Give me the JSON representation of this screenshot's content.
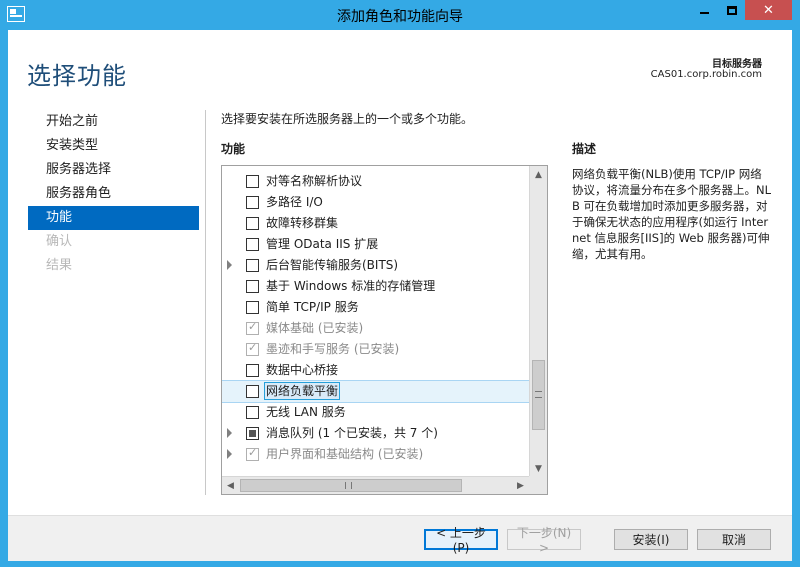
{
  "window": {
    "title": "添加角色和功能向导",
    "app_icon": "server-manager-icon",
    "controls": {
      "minimize": "minimize-icon",
      "maximize": "maximize-icon",
      "close": "✕"
    }
  },
  "header": {
    "page_title": "选择功能",
    "destination_label": "目标服务器",
    "destination_server": "CAS01.corp.robin.com"
  },
  "nav": {
    "items": [
      {
        "label": "开始之前",
        "state": "normal"
      },
      {
        "label": "安装类型",
        "state": "normal"
      },
      {
        "label": "服务器选择",
        "state": "normal"
      },
      {
        "label": "服务器角色",
        "state": "normal"
      },
      {
        "label": "功能",
        "state": "active"
      },
      {
        "label": "确认",
        "state": "disabled"
      },
      {
        "label": "结果",
        "state": "disabled"
      }
    ]
  },
  "main": {
    "instruction": "选择要安装在所选服务器上的一个或多个功能。",
    "features_header": "功能",
    "features": [
      {
        "label": "对等名称解析协议",
        "check": "unchecked",
        "expandable": false,
        "installed": false
      },
      {
        "label": "多路径 I/O",
        "check": "unchecked",
        "expandable": false,
        "installed": false
      },
      {
        "label": "故障转移群集",
        "check": "unchecked",
        "expandable": false,
        "installed": false
      },
      {
        "label": "管理 OData IIS 扩展",
        "check": "unchecked",
        "expandable": false,
        "installed": false
      },
      {
        "label": "后台智能传输服务(BITS)",
        "check": "unchecked",
        "expandable": true,
        "installed": false
      },
      {
        "label": "基于 Windows 标准的存储管理",
        "check": "unchecked",
        "expandable": false,
        "installed": false
      },
      {
        "label": "简单 TCP/IP 服务",
        "check": "unchecked",
        "expandable": false,
        "installed": false
      },
      {
        "label": "媒体基础 (已安装)",
        "check": "checked",
        "expandable": false,
        "installed": true
      },
      {
        "label": "墨迹和手写服务 (已安装)",
        "check": "checked",
        "expandable": false,
        "installed": true
      },
      {
        "label": "数据中心桥接",
        "check": "unchecked",
        "expandable": false,
        "installed": false
      },
      {
        "label": "网络负载平衡",
        "check": "unchecked",
        "expandable": false,
        "installed": false,
        "selected": true
      },
      {
        "label": "无线 LAN 服务",
        "check": "unchecked",
        "expandable": false,
        "installed": false
      },
      {
        "label": "消息队列 (1 个已安装，共 7 个)",
        "check": "partial",
        "expandable": true,
        "installed": false
      },
      {
        "label": "用户界面和基础结构 (已安装)",
        "check": "checked",
        "expandable": true,
        "installed": true
      }
    ],
    "description_header": "描述",
    "description_text": "网络负载平衡(NLB)使用 TCP/IP 网络协议，将流量分布在多个服务器上。NLB 可在负载增加时添加更多服务器，对于确保无状态的应用程序(如运行 Internet 信息服务[IIS]的 Web 服务器)可伸缩，尤其有用。"
  },
  "footer": {
    "prev_label": "< 上一步(P)",
    "next_label": "下一步(N) >",
    "install_label": "安装(I)",
    "cancel_label": "取消"
  }
}
